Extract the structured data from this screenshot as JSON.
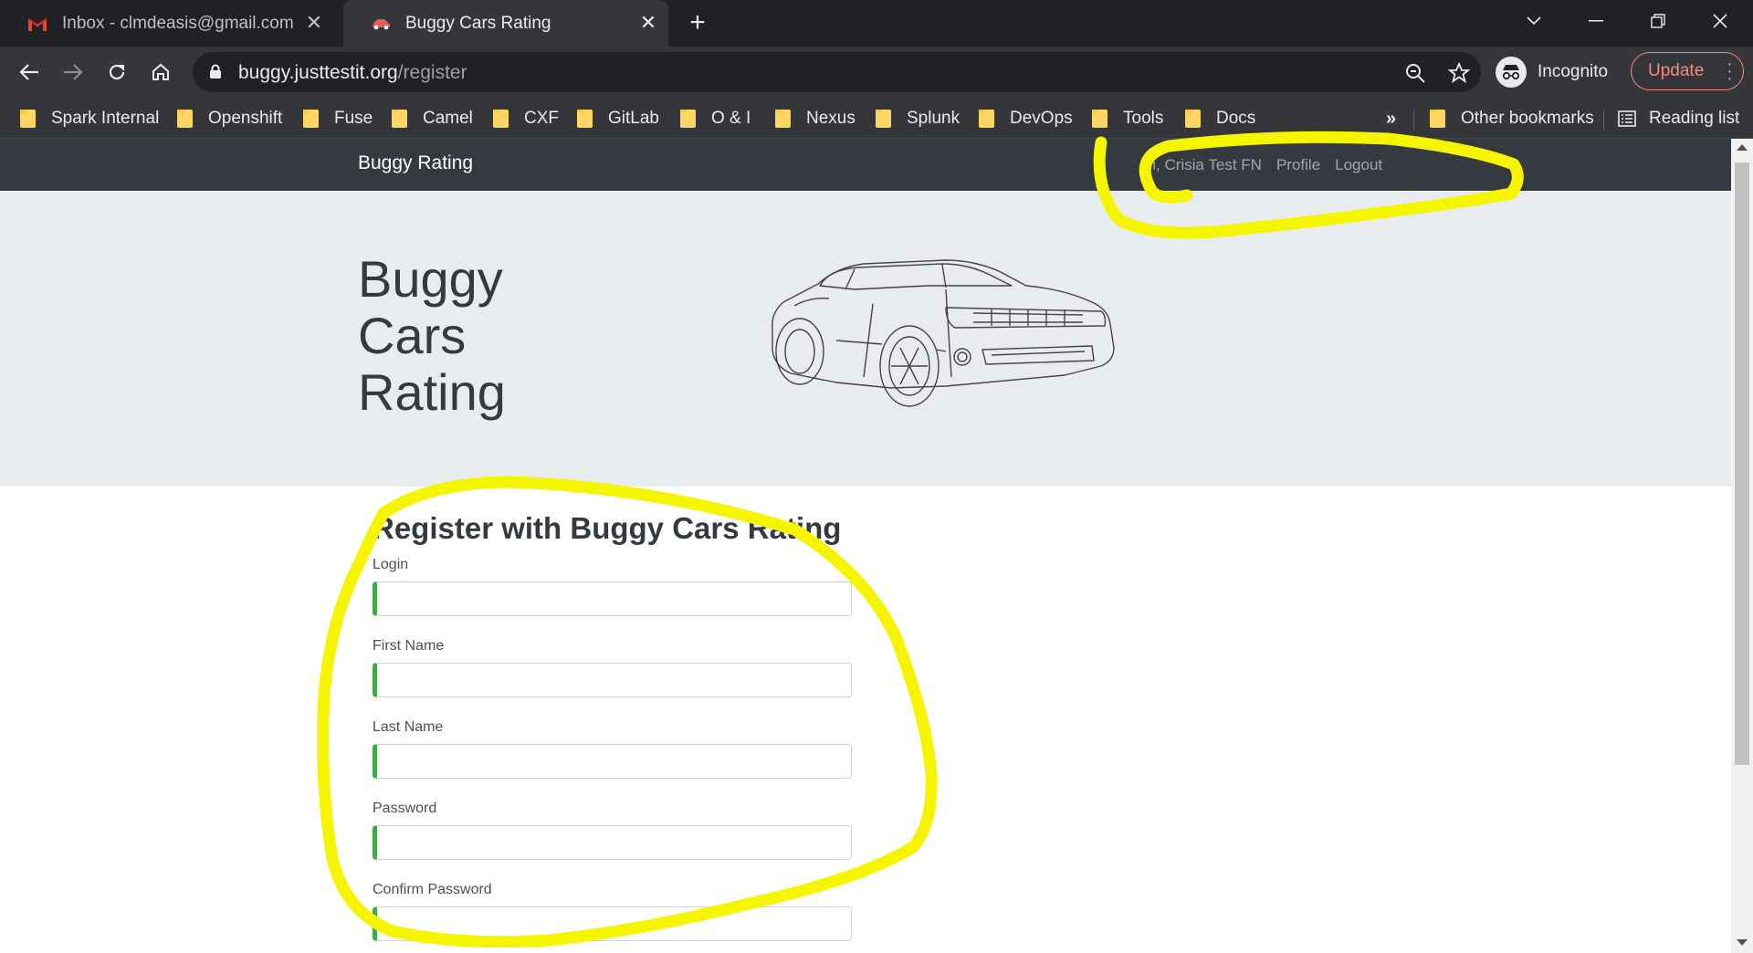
{
  "tabs": [
    {
      "title": "Inbox - clmdeasis@gmail.com - G",
      "icon": "gmail-icon",
      "active": false
    },
    {
      "title": "Buggy Cars Rating",
      "icon": "car-favicon-icon",
      "active": true
    }
  ],
  "address_bar": {
    "domain": "buggy.justtestit.org",
    "path": "/register"
  },
  "profile": {
    "label": "Incognito",
    "update_label": "Update"
  },
  "bookmarks": [
    {
      "label": "Spark Internal"
    },
    {
      "label": "Openshift"
    },
    {
      "label": "Fuse"
    },
    {
      "label": "Camel"
    },
    {
      "label": "CXF"
    },
    {
      "label": "GitLab"
    },
    {
      "label": "O & I"
    },
    {
      "label": "Nexus"
    },
    {
      "label": "Splunk"
    },
    {
      "label": "DevOps"
    },
    {
      "label": "Tools"
    },
    {
      "label": "Docs"
    }
  ],
  "other_bookmarks": "Other bookmarks",
  "reading_list": "Reading list",
  "site": {
    "brand": "Buggy Rating",
    "greeting": "Hi, Crisia Test FN",
    "profile_link": "Profile",
    "logout_link": "Logout",
    "hero_title": "Buggy Cars Rating"
  },
  "form": {
    "title": "Register with Buggy Cars Rating",
    "fields": [
      {
        "label": "Login",
        "value": ""
      },
      {
        "label": "First Name",
        "value": ""
      },
      {
        "label": "Last Name",
        "value": ""
      },
      {
        "label": "Password",
        "value": ""
      },
      {
        "label": "Confirm Password",
        "value": ""
      }
    ]
  },
  "colors": {
    "annotation": "#f5f500",
    "valid_field": "#42a948",
    "navbar": "#343a40",
    "hero": "#e9ecef"
  }
}
